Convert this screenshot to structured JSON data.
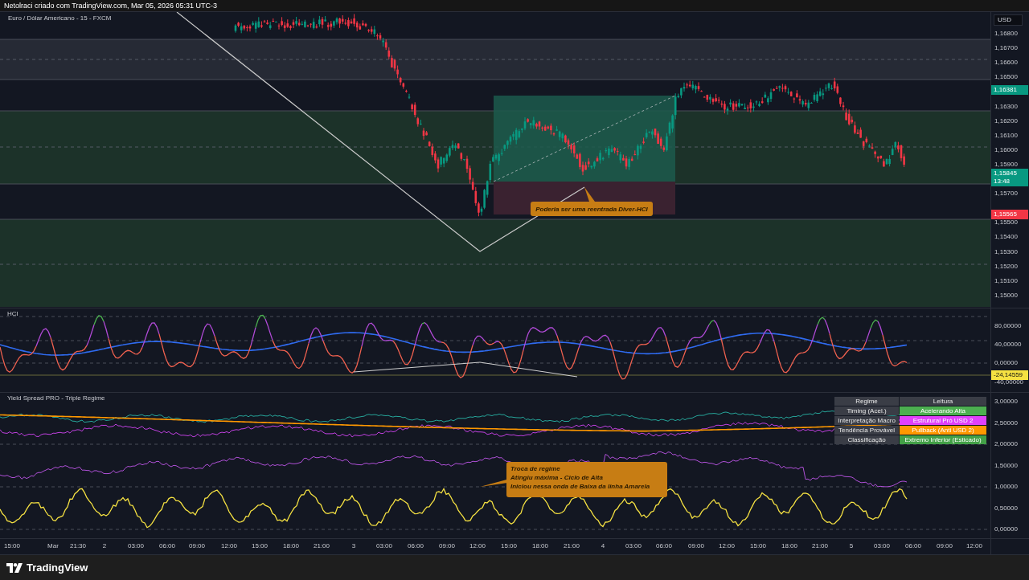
{
  "header": {
    "attribution": "Netolraci criado com TradingView.com, Mar 05, 2026 05:31 UTC-3"
  },
  "main_pane": {
    "symbol": "Euro / Dólar Americano - 15 - FXCM",
    "currency": "USD",
    "price_labels": [
      "1,16800",
      "1,16700",
      "1,16600",
      "1,16500",
      "1,16300",
      "1,16200",
      "1,16100",
      "1,16000",
      "1,15900",
      "1,15700",
      "1,15500",
      "1,15400",
      "1,15300",
      "1,15200",
      "1,15100",
      "1,15000"
    ],
    "price_badges": [
      {
        "value": "1,16381",
        "kind": "up"
      },
      {
        "value": "1,15845",
        "countdown": "13:48",
        "kind": "up"
      },
      {
        "value": "1,15565",
        "kind": "down"
      }
    ],
    "callout": "Poderia ser uma reentrada Diver-HCI"
  },
  "hci_pane": {
    "title": "HCI",
    "scale_labels": [
      "80,00000",
      "40,00000",
      "0,00000",
      "-40,00000"
    ],
    "value_badge": "-24,14559"
  },
  "yield_pane": {
    "title": "Yield Spread PRO - Triple Regime",
    "scale_labels": [
      "3,00000",
      "2,50000",
      "2,00000",
      "1,50000",
      "1,00000",
      "0,50000",
      "0,00000"
    ],
    "regime_table": {
      "columns": [
        "Regime",
        "Leitura"
      ],
      "rows": [
        {
          "label": "Timing (Acel.)",
          "value": "Acelerando Alta",
          "color": "#4caf50"
        },
        {
          "label": "Interpretação Macro",
          "value": "Estrutural Pró USD 2",
          "color": "#e040fb"
        },
        {
          "label": "Tendência Provável",
          "value": "Pullback (Anti USD 2)",
          "color": "#ff9800"
        },
        {
          "label": "Classificação",
          "value": "Extremo Inferior (Esticado)",
          "color": "#43a047"
        }
      ]
    },
    "callout": [
      "Troca de regime",
      "Atingiu máxima - Ciclo de Alta",
      "Iniciou nessa onda de Baixa da linha Amarela"
    ]
  },
  "time_axis": {
    "labels": [
      "15:00",
      "Mar",
      "21:30",
      "2",
      "03:00",
      "06:00",
      "09:00",
      "12:00",
      "15:00",
      "18:00",
      "21:00",
      "3",
      "03:00",
      "06:00",
      "09:00",
      "12:00",
      "15:00",
      "18:00",
      "21:00",
      "4",
      "03:00",
      "06:00",
      "09:00",
      "12:00",
      "15:00",
      "18:00",
      "21:00",
      "5",
      "03:00",
      "06:00",
      "09:00",
      "12:00"
    ]
  },
  "footer": {
    "brand": "TradingView"
  }
}
